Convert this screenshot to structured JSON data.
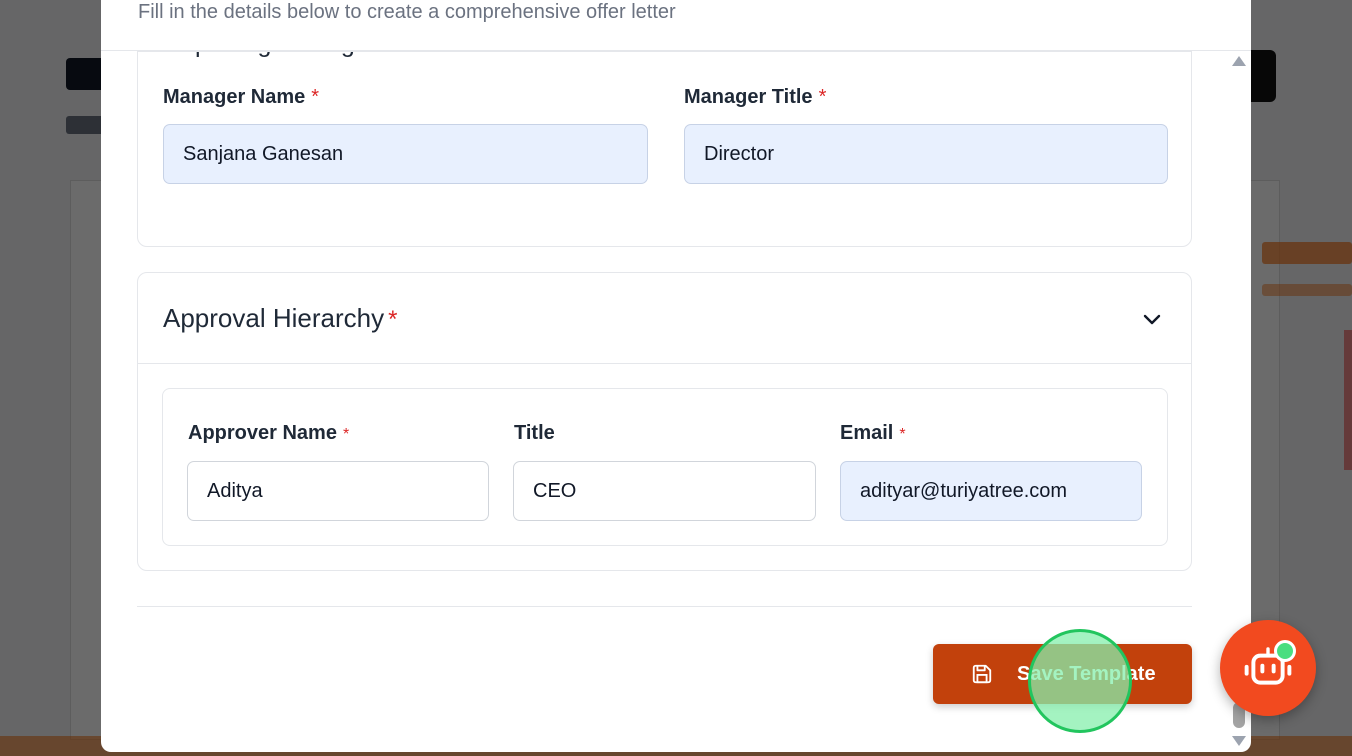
{
  "modal": {
    "description": "Fill in the details below to create a comprehensive offer letter"
  },
  "reporting_manager": {
    "section_title": "Reporting Manager",
    "manager_name_label": "Manager Name",
    "manager_name_value": "Sanjana Ganesan",
    "manager_title_label": "Manager Title",
    "manager_title_value": "Director",
    "required_mark": "*"
  },
  "approval_hierarchy": {
    "section_title": "Approval Hierarchy",
    "required_mark": "*",
    "approver_name_label": "Approver Name",
    "approver_name_value": "Aditya",
    "title_label": "Title",
    "title_value": "CEO",
    "email_label": "Email",
    "email_value": "adityar@turiyatree.com"
  },
  "footer": {
    "save_label": "Save Template"
  },
  "icons": {
    "chevron": "chevron-down-icon",
    "save": "save-icon",
    "bot": "robot-icon"
  },
  "colors": {
    "primary": "#c2410c",
    "fab": "#f24a1f",
    "required": "#dc2626",
    "filled_input": "#e8f0fe"
  }
}
